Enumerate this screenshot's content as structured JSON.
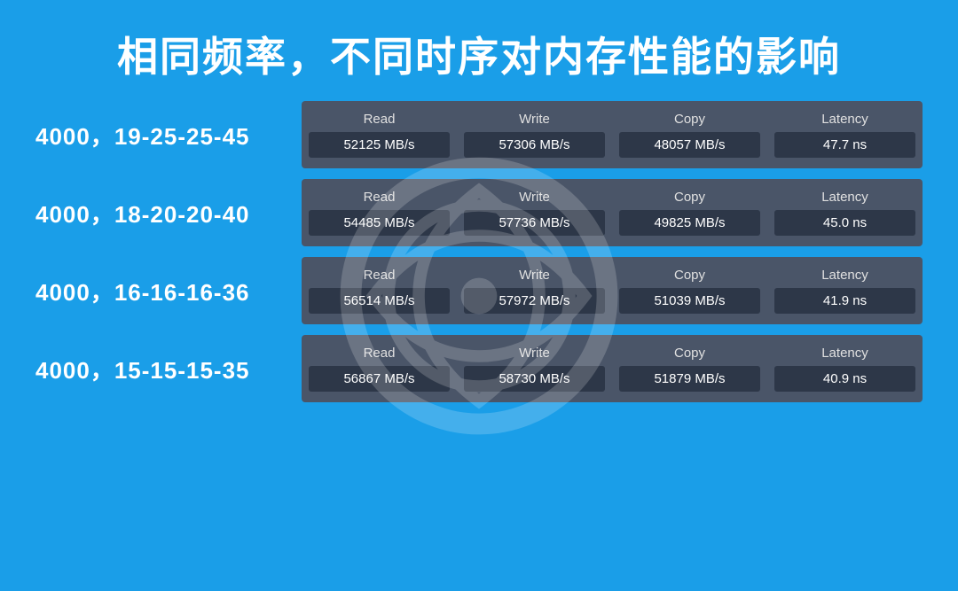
{
  "title": "相同频率，不同时序对内存性能的影响",
  "rows": [
    {
      "label": "4000，19-25-25-45",
      "cols": [
        {
          "header": "Read",
          "value": "52125 MB/s"
        },
        {
          "header": "Write",
          "value": "57306 MB/s"
        },
        {
          "header": "Copy",
          "value": "48057 MB/s"
        },
        {
          "header": "Latency",
          "value": "47.7 ns"
        }
      ]
    },
    {
      "label": "4000，18-20-20-40",
      "cols": [
        {
          "header": "Read",
          "value": "54485 MB/s"
        },
        {
          "header": "Write",
          "value": "57736 MB/s"
        },
        {
          "header": "Copy",
          "value": "49825 MB/s"
        },
        {
          "header": "Latency",
          "value": "45.0 ns"
        }
      ]
    },
    {
      "label": "4000，16-16-16-36",
      "cols": [
        {
          "header": "Read",
          "value": "56514 MB/s"
        },
        {
          "header": "Write",
          "value": "57972 MB/s"
        },
        {
          "header": "Copy",
          "value": "51039 MB/s"
        },
        {
          "header": "Latency",
          "value": "41.9 ns"
        }
      ]
    },
    {
      "label": "4000，15-15-15-35",
      "cols": [
        {
          "header": "Read",
          "value": "56867 MB/s"
        },
        {
          "header": "Write",
          "value": "58730 MB/s"
        },
        {
          "header": "Copy",
          "value": "51879 MB/s"
        },
        {
          "header": "Latency",
          "value": "40.9 ns"
        }
      ]
    }
  ]
}
